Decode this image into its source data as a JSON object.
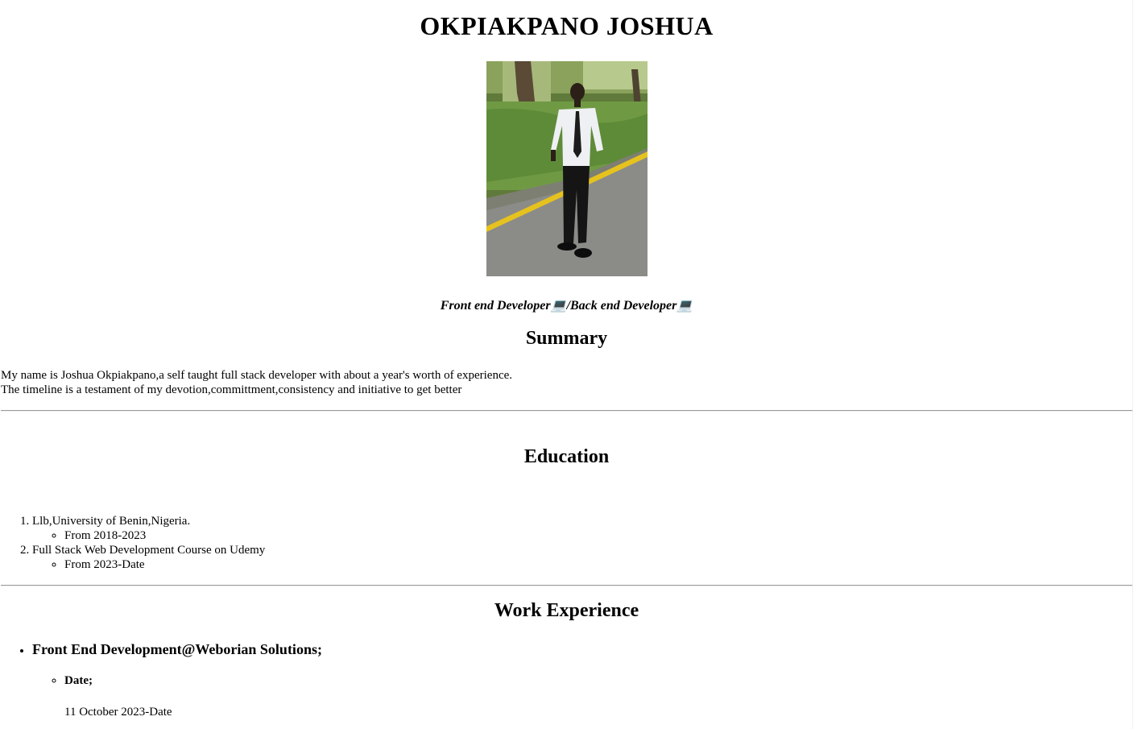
{
  "header": {
    "name": "OKPIAKPANO JOSHUA",
    "tagline": "Front end Developer💻/Back end Developer💻"
  },
  "photo": {
    "alt": "Photo of Joshua Okpiakpano standing on a road wearing a white shirt and black tie"
  },
  "summary": {
    "heading": "Summary",
    "lines": [
      "My name is Joshua Okpiakpano,a self taught full stack developer with about a year's worth of experience.",
      "The timeline is a testament of my devotion,committment,consistency and initiative to get better"
    ]
  },
  "education": {
    "heading": "Education",
    "items": [
      {
        "title": "Llb,University of Benin,Nigeria.",
        "detail": "From 2018-2023"
      },
      {
        "title": "Full Stack Web Development Course on Udemy",
        "detail": "From 2023-Date"
      }
    ]
  },
  "work": {
    "heading": "Work Experience",
    "items": [
      {
        "title": "Front End Development@Weborian Solutions;",
        "date_label": "Date;",
        "date_value": "11 October 2023-Date"
      }
    ]
  },
  "colors": {
    "background": "#ffffff",
    "text": "#000000",
    "rule": "#9a9a9a"
  }
}
